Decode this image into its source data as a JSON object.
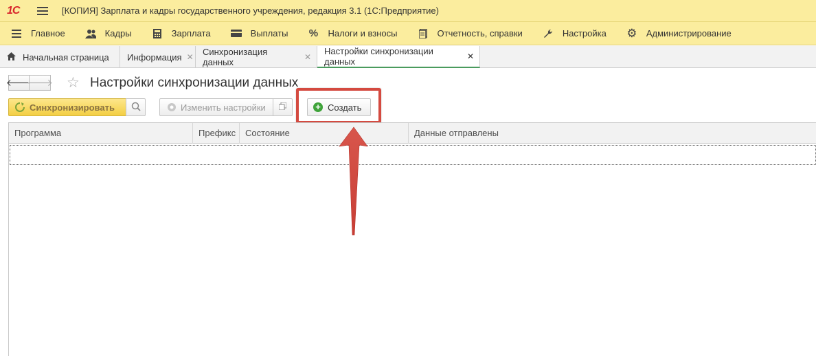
{
  "window": {
    "logo": "1С",
    "title": "[КОПИЯ] Зарплата и кадры государственного учреждения, редакция 3.1  (1С:Предприятие)"
  },
  "menu": {
    "items": [
      {
        "label": "Главное",
        "icon": "hamburger-icon"
      },
      {
        "label": "Кадры",
        "icon": "people-icon"
      },
      {
        "label": "Зарплата",
        "icon": "calculator-icon"
      },
      {
        "label": "Выплаты",
        "icon": "wallet-icon"
      },
      {
        "label": "Налоги и взносы",
        "icon": "percent-icon"
      },
      {
        "label": "Отчетность, справки",
        "icon": "report-icon"
      },
      {
        "label": "Настройка",
        "icon": "wrench-icon"
      },
      {
        "label": "Администрирование",
        "icon": "gear-icon"
      }
    ]
  },
  "tabs": [
    {
      "label": "Начальная страница"
    },
    {
      "label": "Информация"
    },
    {
      "label": "Синхронизация данных"
    },
    {
      "label": "Настройки синхронизации данных",
      "active": true
    }
  ],
  "form": {
    "title": "Настройки синхронизации данных"
  },
  "toolbar": {
    "sync_label": "Синхронизировать",
    "edit_label": "Изменить настройки",
    "create_label": "Создать"
  },
  "table": {
    "columns": [
      "Программа",
      "Префикс",
      "Состояние",
      "Данные отправлены"
    ],
    "rows": []
  },
  "colors": {
    "header_bg": "#fbed9e",
    "accent_green": "#4a9b5e",
    "highlight_red": "#d44a40",
    "sync_button": "#f3cf44"
  }
}
